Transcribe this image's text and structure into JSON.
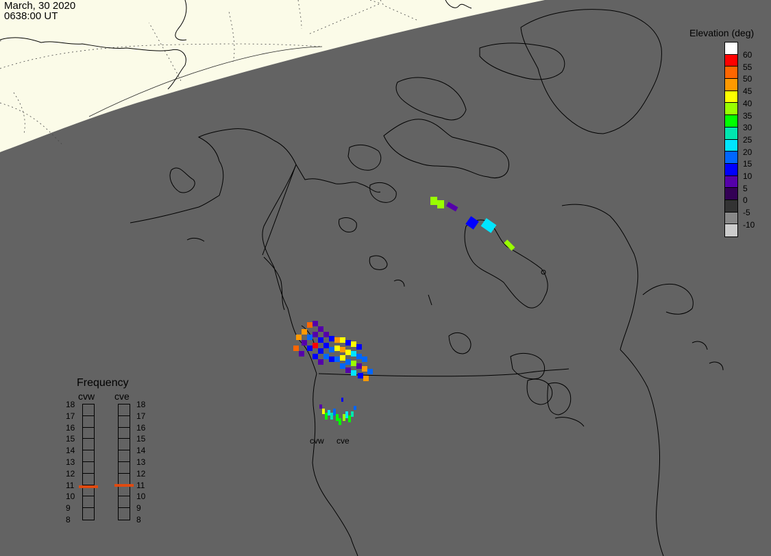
{
  "timestamp": {
    "date": "March, 30 2020",
    "time": "0638:00 UT"
  },
  "colorbar": {
    "title": "Elevation (deg)",
    "levels": [
      {
        "label": "60",
        "color": "#ffffff"
      },
      {
        "label": "55",
        "color": "#ff0000"
      },
      {
        "label": "50",
        "color": "#ff6600"
      },
      {
        "label": "45",
        "color": "#ff9900"
      },
      {
        "label": "40",
        "color": "#ffff00"
      },
      {
        "label": "35",
        "color": "#99ff00"
      },
      {
        "label": "30",
        "color": "#00ff00"
      },
      {
        "label": "25",
        "color": "#00e6b0"
      },
      {
        "label": "20",
        "color": "#00e5ff"
      },
      {
        "label": "15",
        "color": "#0066ff"
      },
      {
        "label": "10",
        "color": "#0000ff"
      },
      {
        "label": "5",
        "color": "#5500aa"
      },
      {
        "label": "0",
        "color": "#330055"
      },
      {
        "label": "-5",
        "color": "#333333"
      },
      {
        "label": "-10",
        "color": "#888888"
      },
      {
        "label": "",
        "color": "#cccccc"
      }
    ]
  },
  "frequency_panel": {
    "title": "Frequency",
    "radars": [
      {
        "name": "cvw",
        "frequency_mhz": 10.8
      },
      {
        "name": "cve",
        "frequency_mhz": 10.9
      }
    ],
    "ticks": [
      "18",
      "17",
      "16",
      "15",
      "14",
      "13",
      "12",
      "11",
      "10",
      "9",
      "8"
    ]
  },
  "radar_sites": [
    {
      "name": "cvw"
    },
    {
      "name": "cve"
    }
  ],
  "colors": {
    "night": "#636363",
    "day": "#fbfbe8",
    "outline": "#000000",
    "marker": "#e04a10"
  }
}
